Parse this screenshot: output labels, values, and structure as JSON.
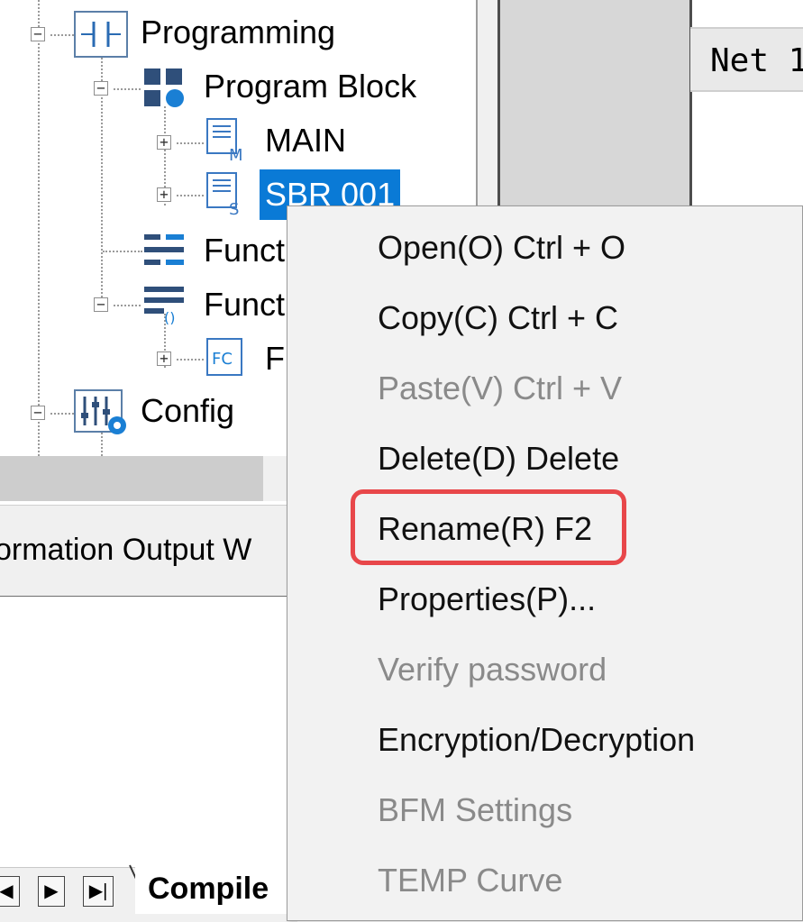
{
  "tree": {
    "items": [
      {
        "label": "Programming",
        "expander": "⊟"
      },
      {
        "label": "Program Block",
        "expander": "⊟"
      },
      {
        "label": "MAIN",
        "expander": "⊞",
        "icon_letter": "M"
      },
      {
        "label": "SBR 001",
        "expander": "⊞",
        "icon_letter": "S"
      },
      {
        "label": "Funct"
      },
      {
        "label": "Funct",
        "expander": "⊟"
      },
      {
        "label": "F",
        "expander": "⊞",
        "icon_letter": "FC"
      },
      {
        "label": "Config",
        "expander": "⊟"
      }
    ],
    "selected_color": "#0078d7"
  },
  "editor": {
    "net_label": "Net 1"
  },
  "output_panel": {
    "title": "ormation Output W"
  },
  "bottom_tabs": {
    "nav_prev": "◀",
    "nav_next": "▶",
    "nav_last": "▶|",
    "compile_label": "Compile"
  },
  "context_menu": {
    "items": [
      {
        "label": "Open(O) Ctrl + O",
        "enabled": true
      },
      {
        "label": "Copy(C) Ctrl + C",
        "enabled": true
      },
      {
        "label": "Paste(V) Ctrl + V",
        "enabled": false
      },
      {
        "label": "Delete(D) Delete",
        "enabled": true
      },
      {
        "label": "Rename(R) F2",
        "enabled": true,
        "highlighted": true
      },
      {
        "label": "Properties(P)...",
        "enabled": true
      },
      {
        "label": "Verify password",
        "enabled": false
      },
      {
        "label": "Encryption/Decryption",
        "enabled": true
      },
      {
        "label": "BFM Settings",
        "enabled": false
      },
      {
        "label": "TEMP Curve",
        "enabled": false
      }
    ],
    "highlight_color": "#e8474a"
  }
}
